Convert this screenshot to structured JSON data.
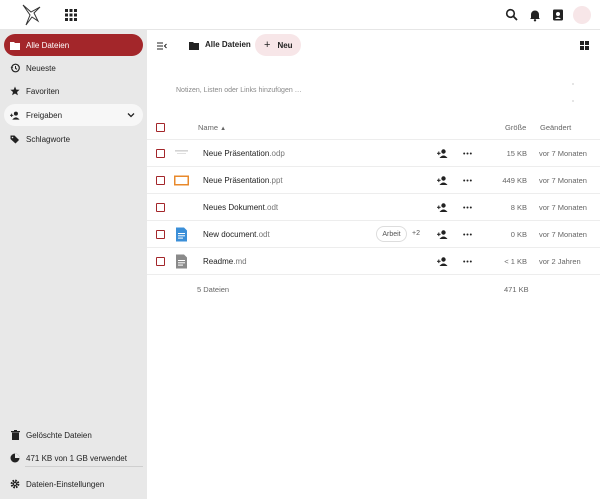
{
  "topbar": {
    "logo_icon": "bird-logo-icon",
    "apps_icon": "app-grid-icon",
    "search_icon": "search-icon",
    "notifications_icon": "bell-icon",
    "contacts_icon": "contacts-icon"
  },
  "sidebar": {
    "items": [
      {
        "label": "Alle Dateien",
        "icon": "folder-icon",
        "active": true
      },
      {
        "label": "Neueste",
        "icon": "history-icon"
      },
      {
        "label": "Favoriten",
        "icon": "star-icon"
      },
      {
        "label": "Freigaben",
        "icon": "share-icon"
      },
      {
        "label": "Schlagworte",
        "icon": "tag-icon"
      }
    ],
    "bottom": {
      "trash_label": "Gelöschte Dateien",
      "quota_label": "471 KB von 1 GB verwendet",
      "settings_label": "Dateien-Einstellungen"
    }
  },
  "breadcrumb": {
    "label": "Alle Dateien",
    "new_button": "Neu"
  },
  "notes": {
    "placeholder": "Notizen, Listen oder Links hinzufügen …"
  },
  "table": {
    "headers": {
      "name": "Name",
      "size": "Größe",
      "modified": "Geändert"
    },
    "rows": [
      {
        "name": "Neue Präsentation",
        "ext": ".odp",
        "size": "15 KB",
        "modified": "vor 7 Monaten",
        "thumb": "odp-thumbnail"
      },
      {
        "name": "Neue Präsentation",
        "ext": ".ppt",
        "size": "449 KB",
        "modified": "vor 7 Monaten",
        "thumb": "ppt-thumbnail"
      },
      {
        "name": "Neues Dokument",
        "ext": ".odt",
        "size": "8 KB",
        "modified": "vor 7 Monaten",
        "thumb": "odt-thumbnail"
      },
      {
        "name": "New document",
        "ext": ".odt",
        "size": "0 KB",
        "modified": "vor 7 Monaten",
        "thumb": "document-icon",
        "tag": "Arbeit",
        "tag_more": "+2"
      },
      {
        "name": "Readme",
        "ext": ".md",
        "size": "< 1 KB",
        "modified": "vor 2 Jahren",
        "thumb": "text-file-icon"
      }
    ],
    "footer": {
      "count": "5 Dateien",
      "size": "471 KB"
    }
  },
  "colors": {
    "accent": "#a3262a",
    "sidebar_bg": "#e8e8e8",
    "new_button_bg": "#f7e6e8"
  }
}
